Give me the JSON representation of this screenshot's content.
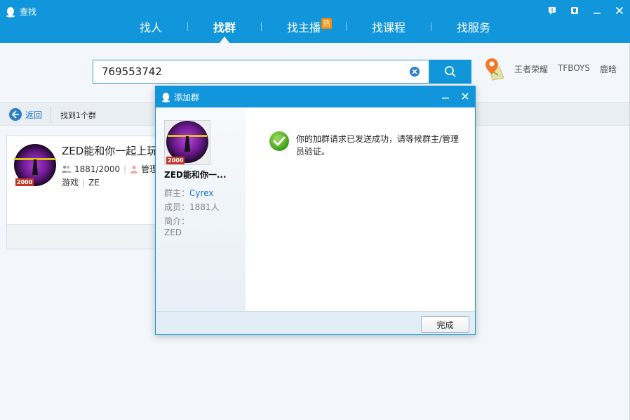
{
  "window": {
    "title": "查找",
    "accent": "#1296db"
  },
  "nav": {
    "tabs": [
      {
        "label": "找人"
      },
      {
        "label": "找群"
      },
      {
        "label": "找主播",
        "badge": "热"
      },
      {
        "label": "找课程"
      },
      {
        "label": "找服务"
      }
    ],
    "active": "找群"
  },
  "search": {
    "value": "769553742",
    "hot_words": [
      "王者荣耀",
      "TFBOYS",
      "鹿晗"
    ]
  },
  "results": {
    "back_label": "返回",
    "count_text": "找到1个群"
  },
  "result_card": {
    "name": "ZED能和你一起上玩",
    "members": "1881/2000",
    "owner_label": "管理",
    "tags": [
      "游戏",
      "ZE"
    ],
    "level_badge": "2000"
  },
  "dialog": {
    "title": "添加群",
    "group_name": "ZED能和你一...",
    "level_badge": "2000",
    "owner_label": "群主：",
    "owner_value": "Cyrex",
    "members_label": "成员：",
    "members_value": "1881人",
    "intro_label": "简介：",
    "intro_value": "ZED",
    "success_message": "你的加群请求已发送成功，请等候群主/管理员验证。",
    "done_label": "完成"
  }
}
